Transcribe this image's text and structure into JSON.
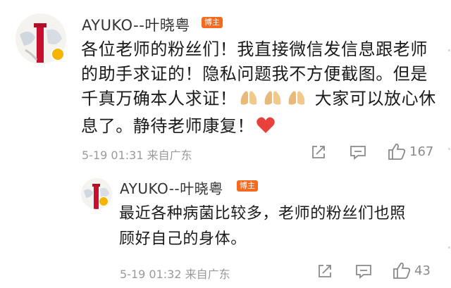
{
  "comment": {
    "username": "AYUKO--叶晓粤",
    "badge": "博主",
    "lines": [
      "各位老师的粉丝们！我直接微信发信息跟老师",
      "的助手求证的！隐私问题我不方便截图。但是",
      "千真万确本人求证！",
      "大家可以放心休",
      "息了。静待老师康复！"
    ],
    "time_location": "5-19 01:31 来自广东",
    "like_count": "167"
  },
  "reply": {
    "username": "AYUKO--叶晓粤",
    "badge": "博主",
    "lines": [
      "最近各种病菌比较多，老师的粉丝们也照",
      "顾好自己的身体。"
    ],
    "time_location": "5-19 01:32 来自广东",
    "like_count": "43"
  },
  "icons": {
    "share": "share-icon",
    "comment": "comment-icon",
    "like": "thumbs-up-icon",
    "pray": "praying-hands-emoji",
    "heart": "red-heart-emoji"
  },
  "colors": {
    "badge": "#f46a1f",
    "heart": "#e8403a",
    "meta": "#9a9a9a"
  }
}
